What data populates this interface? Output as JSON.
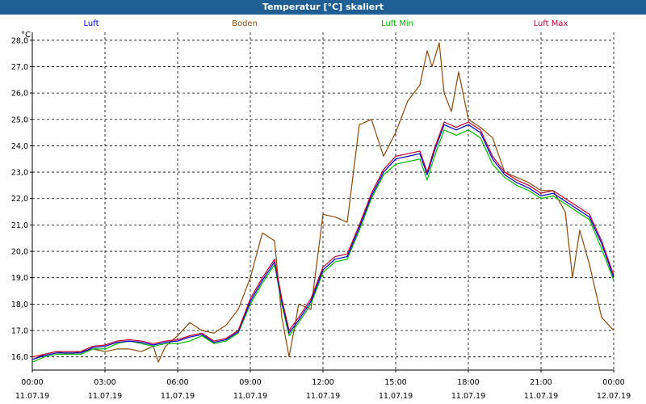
{
  "title": "Temperatur [°C] skaliert",
  "unit": "°C",
  "legend": [
    {
      "label": "Luft",
      "color": "#0000cc"
    },
    {
      "label": "Boden",
      "color": "#8b4a0b"
    },
    {
      "label": "Luft Min",
      "color": "#00bb00"
    },
    {
      "label": "Luft Max",
      "color": "#c00030"
    }
  ],
  "chart_data": {
    "type": "line",
    "title": "Temperatur [°C] skaliert",
    "ylabel": "°C",
    "xlabel": "",
    "ylim": [
      15.5,
      28.3
    ],
    "xlim": [
      0,
      24
    ],
    "grid": true,
    "legend_position": "top",
    "yticks": [
      "16,0",
      "17,0",
      "18,0",
      "19,0",
      "20,0",
      "21,0",
      "22,0",
      "23,0",
      "24,0",
      "25,0",
      "26,0",
      "27,0",
      "28,0"
    ],
    "ytick_values": [
      16,
      17,
      18,
      19,
      20,
      21,
      22,
      23,
      24,
      25,
      26,
      27,
      28
    ],
    "xticks": [
      {
        "time": "00:00",
        "date": "11.07.19"
      },
      {
        "time": "03:00",
        "date": "11.07.19"
      },
      {
        "time": "06:00",
        "date": "11.07.19"
      },
      {
        "time": "09:00",
        "date": "11.07.19"
      },
      {
        "time": "12:00",
        "date": "11.07.19"
      },
      {
        "time": "15:00",
        "date": "11.07.19"
      },
      {
        "time": "18:00",
        "date": "11.07.19"
      },
      {
        "time": "21:00",
        "date": "11.07.19"
      },
      {
        "time": "00:00",
        "date": "12.07.19"
      }
    ],
    "series": [
      {
        "name": "Boden",
        "color": "#8b4a0b",
        "x": [
          0,
          0.5,
          1,
          1.5,
          2,
          2.5,
          3,
          3.5,
          4,
          4.5,
          5,
          5.2,
          5.5,
          6,
          6.5,
          7,
          7.5,
          8,
          8.5,
          9,
          9.5,
          10,
          10.3,
          10.6,
          11,
          11.5,
          12,
          12.5,
          13,
          13.5,
          14,
          14.5,
          15,
          15.5,
          16,
          16.3,
          16.5,
          16.8,
          17,
          17.3,
          17.6,
          18,
          18.5,
          19,
          19.5,
          20,
          20.5,
          21,
          21.5,
          22,
          22.3,
          22.6,
          23,
          23.5,
          24
        ],
        "values": [
          15.9,
          16.1,
          16.2,
          16.1,
          16.2,
          16.3,
          16.2,
          16.3,
          16.3,
          16.2,
          16.4,
          15.8,
          16.4,
          16.8,
          17.3,
          17.0,
          16.9,
          17.2,
          17.8,
          19.0,
          20.7,
          20.4,
          17.5,
          16.0,
          18.0,
          17.8,
          21.4,
          21.3,
          21.1,
          24.8,
          25.0,
          23.6,
          24.5,
          25.7,
          26.3,
          27.6,
          27.0,
          27.9,
          26.0,
          25.3,
          26.8,
          25.0,
          24.7,
          24.3,
          23.0,
          22.8,
          22.6,
          22.3,
          22.3,
          21.5,
          19.0,
          20.8,
          19.5,
          17.5,
          17.0
        ]
      },
      {
        "name": "Luft Min",
        "color": "#00bb00",
        "x": [
          0,
          0.5,
          1,
          1.5,
          2,
          2.5,
          3,
          3.5,
          4,
          4.5,
          5,
          5.5,
          6,
          6.5,
          7,
          7.5,
          8,
          8.5,
          9,
          9.5,
          10,
          10.3,
          10.6,
          11,
          11.5,
          12,
          12.5,
          13,
          13.5,
          14,
          14.5,
          15,
          15.5,
          16,
          16.3,
          16.6,
          17,
          17.5,
          18,
          18.5,
          19,
          19.5,
          20,
          20.5,
          21,
          21.5,
          22,
          22.5,
          23,
          23.5,
          24
        ],
        "values": [
          15.8,
          16.0,
          16.1,
          16.1,
          16.1,
          16.3,
          16.3,
          16.5,
          16.6,
          16.5,
          16.4,
          16.5,
          16.5,
          16.6,
          16.8,
          16.5,
          16.6,
          16.9,
          18.0,
          18.8,
          19.5,
          18.0,
          16.8,
          17.3,
          18.0,
          19.2,
          19.6,
          19.7,
          20.8,
          22.0,
          22.9,
          23.3,
          23.4,
          23.5,
          22.7,
          23.6,
          24.6,
          24.4,
          24.6,
          24.3,
          23.3,
          22.8,
          22.5,
          22.3,
          22.0,
          22.1,
          21.8,
          21.5,
          21.2,
          20.1,
          18.9
        ]
      },
      {
        "name": "Luft",
        "color": "#0000cc",
        "x": [
          0,
          0.5,
          1,
          1.5,
          2,
          2.5,
          3,
          3.5,
          4,
          4.5,
          5,
          5.5,
          6,
          6.5,
          7,
          7.5,
          8,
          8.5,
          9,
          9.5,
          10,
          10.3,
          10.6,
          11,
          11.5,
          12,
          12.5,
          13,
          13.5,
          14,
          14.5,
          15,
          15.5,
          16,
          16.3,
          16.6,
          17,
          17.5,
          18,
          18.5,
          19,
          19.5,
          20,
          20.5,
          21,
          21.5,
          22,
          22.5,
          23,
          23.5,
          24
        ],
        "values": [
          15.9,
          16.05,
          16.15,
          16.15,
          16.15,
          16.35,
          16.4,
          16.55,
          16.6,
          16.55,
          16.45,
          16.55,
          16.6,
          16.75,
          16.85,
          16.55,
          16.65,
          16.95,
          18.1,
          18.9,
          19.6,
          18.1,
          16.9,
          17.4,
          18.1,
          19.3,
          19.7,
          19.8,
          20.9,
          22.1,
          23.0,
          23.5,
          23.6,
          23.7,
          22.9,
          23.8,
          24.8,
          24.6,
          24.8,
          24.5,
          23.5,
          22.9,
          22.6,
          22.4,
          22.1,
          22.2,
          21.9,
          21.6,
          21.3,
          20.3,
          19.0
        ]
      },
      {
        "name": "Luft Max",
        "color": "#c00030",
        "x": [
          0,
          0.5,
          1,
          1.5,
          2,
          2.5,
          3,
          3.5,
          4,
          4.5,
          5,
          5.5,
          6,
          6.5,
          7,
          7.5,
          8,
          8.5,
          9,
          9.5,
          10,
          10.3,
          10.6,
          11,
          11.5,
          12,
          12.5,
          13,
          13.5,
          14,
          14.5,
          15,
          15.5,
          16,
          16.3,
          16.6,
          17,
          17.5,
          18,
          18.5,
          19,
          19.5,
          20,
          20.5,
          21,
          21.5,
          22,
          22.5,
          23,
          23.5,
          24
        ],
        "values": [
          16.0,
          16.1,
          16.2,
          16.2,
          16.2,
          16.4,
          16.45,
          16.6,
          16.65,
          16.6,
          16.5,
          16.6,
          16.65,
          16.8,
          16.9,
          16.6,
          16.7,
          17.0,
          18.2,
          19.0,
          19.7,
          18.2,
          17.0,
          17.5,
          18.2,
          19.4,
          19.8,
          19.9,
          21.0,
          22.2,
          23.1,
          23.6,
          23.7,
          23.8,
          23.0,
          23.9,
          24.9,
          24.7,
          24.9,
          24.6,
          23.6,
          23.0,
          22.7,
          22.5,
          22.2,
          22.3,
          22.0,
          21.7,
          21.4,
          20.4,
          19.1
        ]
      }
    ]
  }
}
